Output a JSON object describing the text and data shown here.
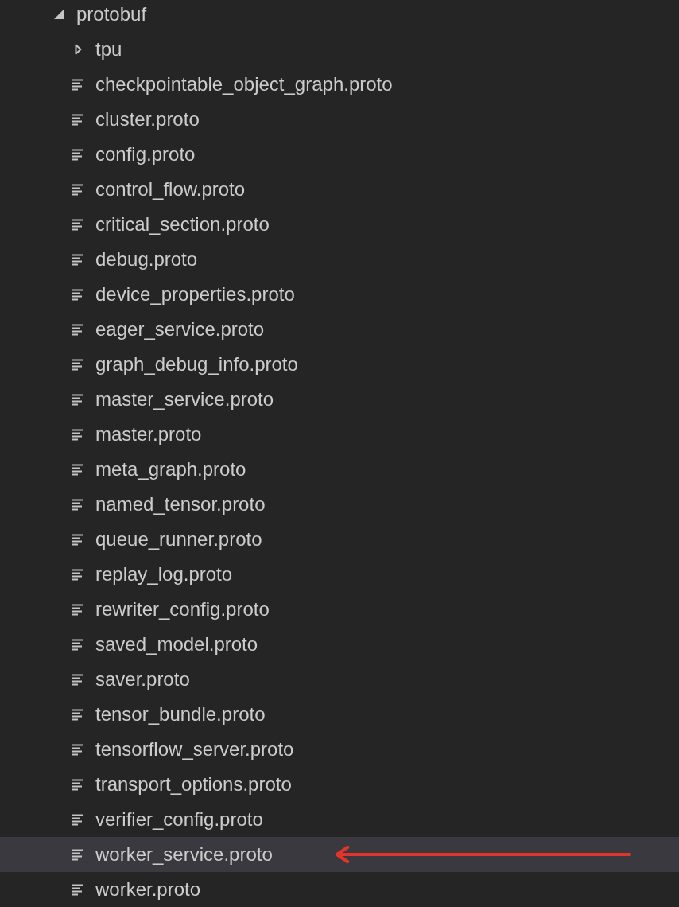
{
  "tree": [
    {
      "label": "protobuf",
      "kind": "folder",
      "expanded": true,
      "selected": false,
      "children": [
        {
          "label": "tpu",
          "kind": "folder",
          "expanded": false,
          "selected": false
        },
        {
          "label": "checkpointable_object_graph.proto",
          "kind": "file",
          "selected": false
        },
        {
          "label": "cluster.proto",
          "kind": "file",
          "selected": false
        },
        {
          "label": "config.proto",
          "kind": "file",
          "selected": false
        },
        {
          "label": "control_flow.proto",
          "kind": "file",
          "selected": false
        },
        {
          "label": "critical_section.proto",
          "kind": "file",
          "selected": false
        },
        {
          "label": "debug.proto",
          "kind": "file",
          "selected": false
        },
        {
          "label": "device_properties.proto",
          "kind": "file",
          "selected": false
        },
        {
          "label": "eager_service.proto",
          "kind": "file",
          "selected": false
        },
        {
          "label": "graph_debug_info.proto",
          "kind": "file",
          "selected": false
        },
        {
          "label": "master_service.proto",
          "kind": "file",
          "selected": false
        },
        {
          "label": "master.proto",
          "kind": "file",
          "selected": false
        },
        {
          "label": "meta_graph.proto",
          "kind": "file",
          "selected": false
        },
        {
          "label": "named_tensor.proto",
          "kind": "file",
          "selected": false
        },
        {
          "label": "queue_runner.proto",
          "kind": "file",
          "selected": false
        },
        {
          "label": "replay_log.proto",
          "kind": "file",
          "selected": false
        },
        {
          "label": "rewriter_config.proto",
          "kind": "file",
          "selected": false
        },
        {
          "label": "saved_model.proto",
          "kind": "file",
          "selected": false
        },
        {
          "label": "saver.proto",
          "kind": "file",
          "selected": false
        },
        {
          "label": "tensor_bundle.proto",
          "kind": "file",
          "selected": false
        },
        {
          "label": "tensorflow_server.proto",
          "kind": "file",
          "selected": false
        },
        {
          "label": "transport_options.proto",
          "kind": "file",
          "selected": false
        },
        {
          "label": "verifier_config.proto",
          "kind": "file",
          "selected": false
        },
        {
          "label": "worker_service.proto",
          "kind": "file",
          "selected": true
        },
        {
          "label": "worker.proto",
          "kind": "file",
          "selected": false
        }
      ]
    }
  ]
}
